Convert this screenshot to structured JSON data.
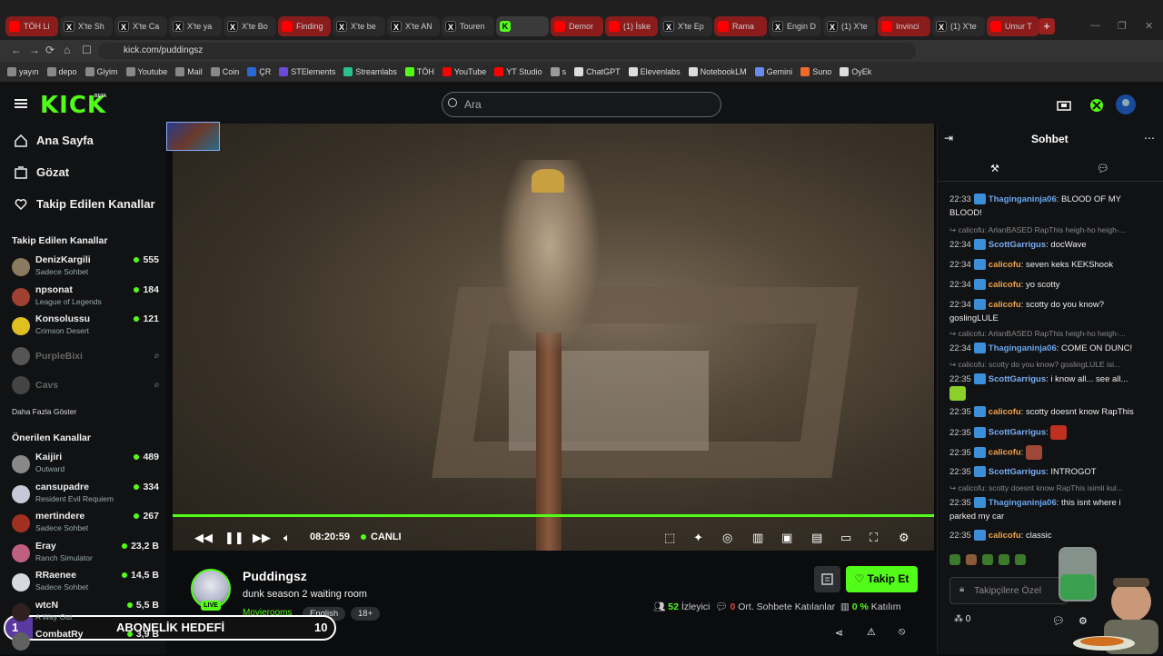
{
  "browser": {
    "tabs": [
      {
        "label": "TÖH Li",
        "icon": "yt"
      },
      {
        "label": "X'te Sh",
        "icon": "x"
      },
      {
        "label": "X'te Ca",
        "icon": "x"
      },
      {
        "label": "X'te ya",
        "icon": "x"
      },
      {
        "label": "X'te Bo",
        "icon": "x"
      },
      {
        "label": "Finding",
        "icon": "yt"
      },
      {
        "label": "X'te be",
        "icon": "x"
      },
      {
        "label": "X'te AN",
        "icon": "x"
      },
      {
        "label": "Touren",
        "icon": "x"
      },
      {
        "label": "",
        "icon": "k"
      },
      {
        "label": "Demor",
        "icon": "yt"
      },
      {
        "label": "(1) İske",
        "icon": "yt"
      },
      {
        "label": "X'te Ep",
        "icon": "x"
      },
      {
        "label": "Rama",
        "icon": "yt"
      },
      {
        "label": "Engin D",
        "icon": "x"
      },
      {
        "label": "(1) X'te",
        "icon": "x"
      },
      {
        "label": "Invinci",
        "icon": "yt"
      },
      {
        "label": "(1) X'te",
        "icon": "x"
      },
      {
        "label": "Umur T",
        "icon": "yt"
      }
    ],
    "new_tab": "+",
    "url": "kick.com/puddingsz",
    "bookmarks": [
      "yayın",
      "depo",
      "Giyim",
      "Youtube",
      "Mail",
      "Coin",
      "ÇR",
      "STElements",
      "Streamlabs",
      "TÖH",
      "YouTube",
      "YT Studio",
      "s",
      "ChatGPT",
      "Elevenlabs",
      "NotebookLM",
      "Gemini",
      "Suno",
      "OyEk"
    ]
  },
  "header": {
    "logo": "KICK",
    "beta": "BETA",
    "search_placeholder": "Ara"
  },
  "sidebar": {
    "nav": [
      {
        "label": "Ana Sayfa",
        "icon": "home-icon"
      },
      {
        "label": "Gözat",
        "icon": "browse-icon"
      },
      {
        "label": "Takip Edilen Kanallar",
        "icon": "heart-icon"
      }
    ],
    "followed_title": "Takip Edilen Kanallar",
    "followed": [
      {
        "name": "DenizKargili",
        "game": "Sadece Sohbet",
        "viewers": "555",
        "color": "#8a7a60"
      },
      {
        "name": "npsonat",
        "game": "League of Legends",
        "viewers": "184",
        "color": "#a04030"
      },
      {
        "name": "Konsolussu",
        "game": "Crimson Desert",
        "viewers": "121",
        "color": "#e0c020"
      },
      {
        "name": "PurpleBixi",
        "game": "",
        "viewers": "",
        "color": "#555"
      },
      {
        "name": "Cavs",
        "game": "",
        "viewers": "",
        "color": "#444"
      }
    ],
    "show_more": "Daha Fazla Göster",
    "recommended_title": "Önerilen Kanallar",
    "recommended": [
      {
        "name": "Kaijiri",
        "game": "Outward",
        "viewers": "489",
        "color": "#888"
      },
      {
        "name": "cansupadre",
        "game": "Resident Evil Requiem",
        "viewers": "334",
        "color": "#c8c8d8"
      },
      {
        "name": "mertindere",
        "game": "Sadece Sohbet",
        "viewers": "267",
        "color": "#a03020"
      },
      {
        "name": "Eray",
        "game": "Ranch Simulator",
        "viewers": "23,2 B",
        "color": "#c06080"
      },
      {
        "name": "RRaenee",
        "game": "Sadece Sohbet",
        "viewers": "14,5 B",
        "color": "#d8d8e0"
      },
      {
        "name": "wtcN",
        "game": "A Way Out",
        "viewers": "5,5 B",
        "color": "#302020"
      },
      {
        "name": "CombatRy",
        "game": "",
        "viewers": "3,9 B",
        "color": "#606060"
      }
    ]
  },
  "player": {
    "time": "08:20:59",
    "live_label": "CANLI",
    "progress_percent": 100
  },
  "stream": {
    "streamer": "Puddingsz",
    "title": "dunk season 2 waiting room",
    "category": "Movierooms",
    "tags": [
      "English",
      "18+"
    ],
    "live_badge": "LIVE",
    "follow_label": "Takip Et",
    "viewers": "52",
    "viewers_label": "İzleyici",
    "avg_chat": "0",
    "avg_chat_label": "Ort. Sohbete Katılanlar",
    "participation": "0 %",
    "participation_label": "Katılım"
  },
  "chat": {
    "title": "Sohbet",
    "messages": [
      {
        "time": "22:33",
        "user": "Thaginganinja06",
        "text": "BLOOD OF MY BLOOD!",
        "ucls": "u1"
      },
      {
        "reply": "calicofu: ArlanBASED RapThis heigh-ho heigh-..."
      },
      {
        "time": "22:34",
        "user": "ScottGarrigus",
        "text": "docWave",
        "ucls": "u3"
      },
      {
        "time": "22:34",
        "user": "calicofu",
        "text": "seven keks KEKShook",
        "ucls": "u2"
      },
      {
        "time": "22:34",
        "user": "calicofu",
        "text": "yo scotty",
        "ucls": "u2"
      },
      {
        "time": "22:34",
        "user": "calicofu",
        "text": "scotty do you know? goslingLULE",
        "ucls": "u2"
      },
      {
        "reply": "calicofu: ArlanBASED RapThis heigh-ho heigh-..."
      },
      {
        "time": "22:34",
        "user": "Thaginganinja06",
        "text": "COME ON DUNC!",
        "ucls": "u1"
      },
      {
        "reply": "calicofu: scotty do you know? goslingLULE isi..."
      },
      {
        "time": "22:35",
        "user": "ScottGarrigus",
        "text": "i know all... see all...",
        "ucls": "u3"
      },
      {
        "time": "22:35",
        "user": "calicofu",
        "text": "scotty doesnt know RapThis",
        "ucls": "u2"
      },
      {
        "time": "22:35",
        "user": "ScottGarrigus",
        "text": "",
        "ucls": "u3"
      },
      {
        "time": "22:35",
        "user": "calicofu",
        "text": "",
        "ucls": "u2"
      },
      {
        "time": "22:35",
        "user": "ScottGarrigus",
        "text": "INTROGOT",
        "ucls": "u3"
      },
      {
        "reply": "calicofu: scotty doesnt know RapThis isimli kul..."
      },
      {
        "time": "22:35",
        "user": "Thaginganinja06",
        "text": "this isnt where i parked my car",
        "ucls": "u1"
      },
      {
        "time": "22:35",
        "user": "calicofu",
        "text": "classic",
        "ucls": "u2"
      }
    ],
    "input_placeholder": "Takipçilere Özel",
    "count": "0"
  },
  "goal": {
    "current": "1",
    "label": "ABONELİK HEDEFİ",
    "target": "10"
  }
}
